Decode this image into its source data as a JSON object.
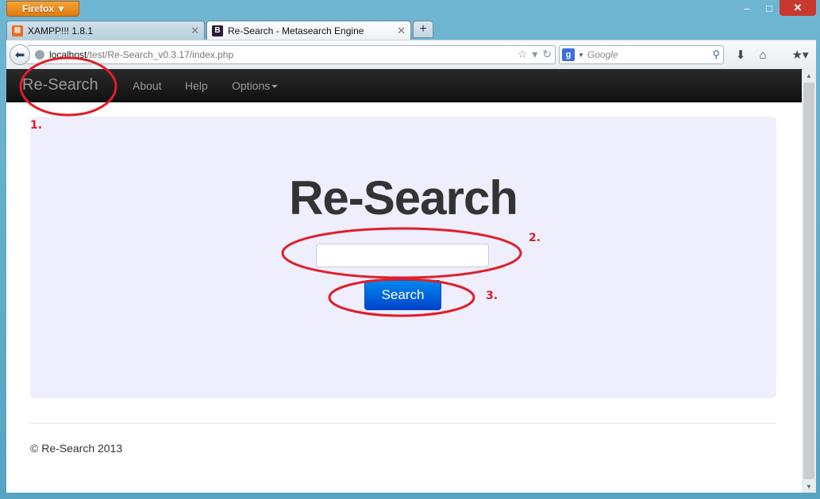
{
  "browser": {
    "app_button": "Firefox",
    "window_controls": {
      "minimize": "–",
      "maximize": "□",
      "close": "✕"
    },
    "tabs": [
      {
        "label": "XAMPP!!! 1.8.1",
        "icon": "xampp-icon",
        "active": false
      },
      {
        "label": "Re-Search - Metasearch Engine",
        "icon": "bootstrap-icon",
        "icon_letter": "B",
        "active": true
      }
    ],
    "new_tab_label": "+",
    "url_host": "localhost",
    "url_path": "/test/Re-Search_v0.3.17/index.php",
    "search_placeholder": "Google",
    "search_engine_letter": "g"
  },
  "site": {
    "brand": "Re-Search",
    "nav": [
      {
        "label": "About"
      },
      {
        "label": "Help"
      },
      {
        "label": "Options"
      }
    ],
    "hero_title": "Re-Search",
    "search_input_value": "",
    "search_button": "Search",
    "footer": "© Re-Search 2013"
  },
  "annotations": {
    "labels": [
      "1.",
      "2.",
      "3."
    ],
    "color": "#e01e2a"
  },
  "colors": {
    "navbar": "#1b1b1b",
    "hero_bg": "#eeeefd",
    "button": "#0055dd"
  }
}
